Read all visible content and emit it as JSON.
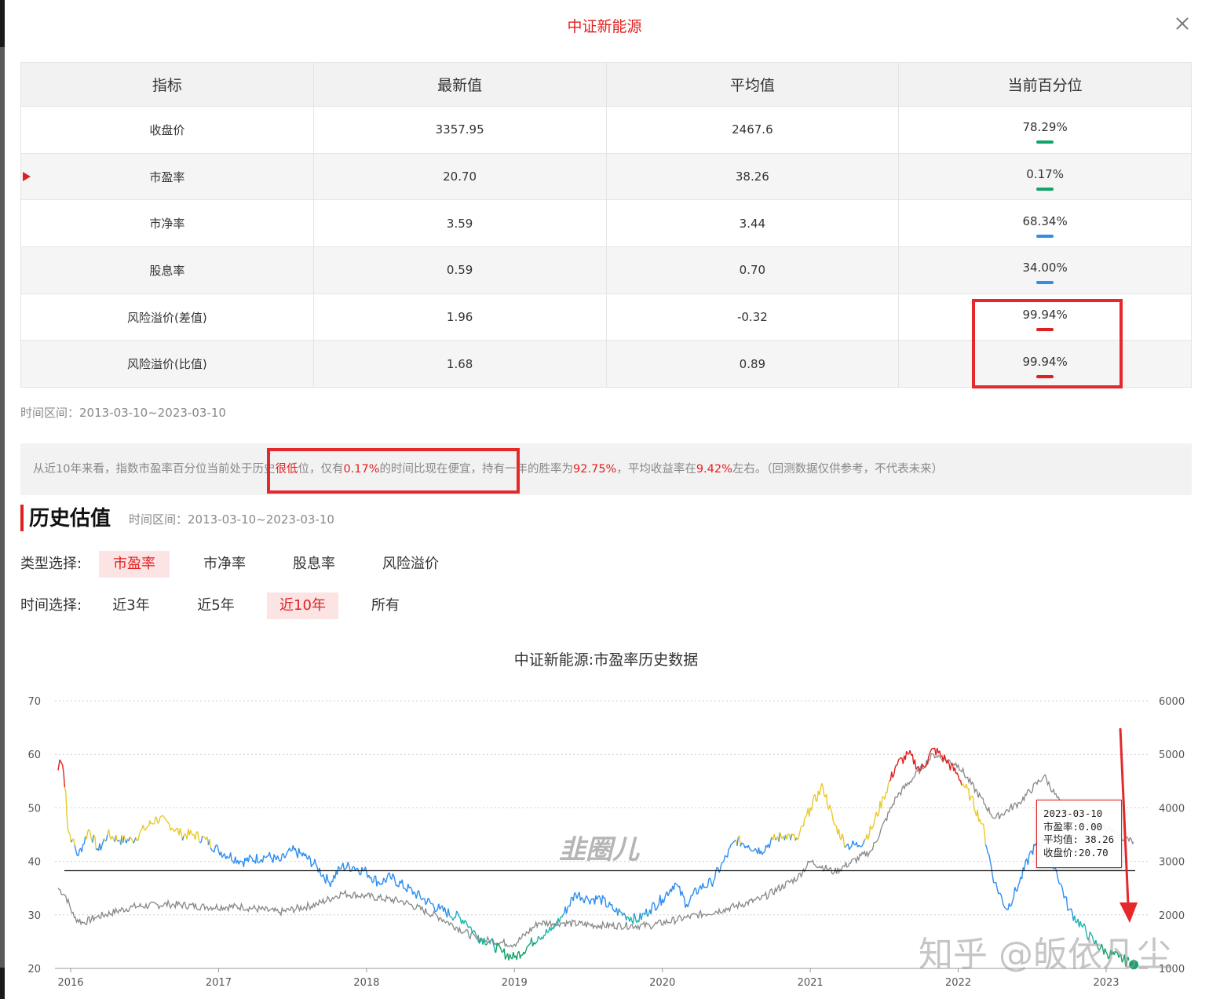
{
  "modal": {
    "title": "中证新能源"
  },
  "table": {
    "headers": [
      "指标",
      "最新值",
      "平均值",
      "当前百分位"
    ],
    "rows": [
      {
        "name": "收盘价",
        "latest": "3357.95",
        "avg": "2467.6",
        "pct": "78.29%",
        "bar_color": "#13a36b"
      },
      {
        "name": "市盈率",
        "latest": "20.70",
        "avg": "38.26",
        "pct": "0.17%",
        "bar_color": "#13a36b"
      },
      {
        "name": "市净率",
        "latest": "3.59",
        "avg": "3.44",
        "pct": "68.34%",
        "bar_color": "#2e8ef0"
      },
      {
        "name": "股息率",
        "latest": "0.59",
        "avg": "0.70",
        "pct": "34.00%",
        "bar_color": "#2e8ef0"
      },
      {
        "name": "风险溢价(差值)",
        "latest": "1.96",
        "avg": "-0.32",
        "pct": "99.94%",
        "bar_color": "#e02020"
      },
      {
        "name": "风险溢价(比值)",
        "latest": "1.68",
        "avg": "0.89",
        "pct": "99.94%",
        "bar_color": "#e02020"
      }
    ]
  },
  "range_text": "时间区间：2013-03-10~2023-03-10",
  "summary": {
    "p1": "从近10年来看，指数市盈率百分位当前处于历史",
    "r1": "很低",
    "p2": "位，仅有",
    "r2": "0.17%",
    "p3": "的时间比现在便宜，持有一年的胜率为",
    "r3": "92.75%",
    "p4": "，平均收益率在",
    "r4": "9.42%",
    "p5": "左右。（回测数据仅供参考，不代表未来）"
  },
  "history": {
    "title": "历史估值",
    "range": "时间区间：2013-03-10~2023-03-10",
    "type_label": "类型选择:",
    "types": [
      "市盈率",
      "市净率",
      "股息率",
      "风险溢价"
    ],
    "time_label": "时间选择:",
    "times": [
      "近3年",
      "近5年",
      "近10年",
      "所有"
    ]
  },
  "chart_data": {
    "type": "line",
    "title": "中证新能源:市盈率历史数据",
    "x_ticks": [
      "2016",
      "2017",
      "2018",
      "2019",
      "2020",
      "2021",
      "2022",
      "2023"
    ],
    "y_left": {
      "ticks": [
        20,
        30,
        40,
        50,
        60,
        70
      ],
      "range": [
        20,
        70
      ]
    },
    "y_right": {
      "ticks": [
        1000,
        2000,
        3000,
        4000,
        5000,
        6000
      ],
      "range": [
        1000,
        6000
      ]
    },
    "average_pe": 38.26,
    "series": [
      {
        "axis": "left",
        "color_bands": {
          "high": "#e02020",
          "mid": "#e8c92a",
          "low": "#2e8ef0",
          "very_low": "#1fb5b0",
          "bottom": "#13a36b"
        },
        "points": [
          [
            "2015-12-01",
            57
          ],
          [
            "2015-12-05",
            59
          ],
          [
            "2015-12-12",
            58
          ],
          [
            "2015-12-20",
            53
          ],
          [
            "2015-12-25",
            46
          ],
          [
            "2016-01-05",
            44
          ],
          [
            "2016-01-20",
            41
          ],
          [
            "2016-02-15",
            46
          ],
          [
            "2016-03-10",
            42
          ],
          [
            "2016-04-01",
            45
          ],
          [
            "2016-05-01",
            44
          ],
          [
            "2016-06-01",
            44
          ],
          [
            "2016-07-01",
            46
          ],
          [
            "2016-08-01",
            48
          ],
          [
            "2016-09-01",
            47
          ],
          [
            "2016-10-01",
            45
          ],
          [
            "2016-11-01",
            45
          ],
          [
            "2016-12-01",
            44
          ],
          [
            "2017-01-01",
            42
          ],
          [
            "2017-03-01",
            40
          ],
          [
            "2017-05-01",
            41
          ],
          [
            "2017-06-01",
            40
          ],
          [
            "2017-07-01",
            42
          ],
          [
            "2017-08-01",
            41
          ],
          [
            "2017-09-01",
            39
          ],
          [
            "2017-10-01",
            36
          ],
          [
            "2017-11-01",
            39
          ],
          [
            "2017-12-01",
            39
          ],
          [
            "2018-01-01",
            38
          ],
          [
            "2018-02-01",
            36
          ],
          [
            "2018-03-01",
            37
          ],
          [
            "2018-05-01",
            34
          ],
          [
            "2018-07-01",
            31
          ],
          [
            "2018-09-01",
            29
          ],
          [
            "2018-10-01",
            26
          ],
          [
            "2018-11-01",
            25
          ],
          [
            "2018-12-01",
            23
          ],
          [
            "2019-01-01",
            22
          ],
          [
            "2019-02-01",
            24
          ],
          [
            "2019-03-01",
            26
          ],
          [
            "2019-04-01",
            27
          ],
          [
            "2019-05-01",
            30
          ],
          [
            "2019-06-01",
            34
          ],
          [
            "2019-07-01",
            33
          ],
          [
            "2019-08-01",
            33
          ],
          [
            "2019-09-01",
            31
          ],
          [
            "2019-10-01",
            30
          ],
          [
            "2019-11-01",
            29
          ],
          [
            "2019-12-01",
            31
          ],
          [
            "2020-01-01",
            33
          ],
          [
            "2020-02-01",
            36
          ],
          [
            "2020-03-01",
            32
          ],
          [
            "2020-04-01",
            35
          ],
          [
            "2020-05-01",
            36
          ],
          [
            "2020-06-01",
            40
          ],
          [
            "2020-07-01",
            44
          ],
          [
            "2020-08-01",
            43
          ],
          [
            "2020-09-01",
            42
          ],
          [
            "2020-10-01",
            44
          ],
          [
            "2020-11-01",
            45
          ],
          [
            "2020-12-01",
            44
          ],
          [
            "2021-01-01",
            50
          ],
          [
            "2021-02-01",
            54
          ],
          [
            "2021-03-01",
            47
          ],
          [
            "2021-04-01",
            43
          ],
          [
            "2021-05-01",
            43
          ],
          [
            "2021-06-01",
            46
          ],
          [
            "2021-07-01",
            52
          ],
          [
            "2021-08-01",
            58
          ],
          [
            "2021-09-01",
            60
          ],
          [
            "2021-10-01",
            57
          ],
          [
            "2021-11-01",
            61
          ],
          [
            "2021-12-01",
            59
          ],
          [
            "2022-01-01",
            56
          ],
          [
            "2022-02-01",
            52
          ],
          [
            "2022-03-01",
            47
          ],
          [
            "2022-04-01",
            36
          ],
          [
            "2022-05-01",
            31
          ],
          [
            "2022-06-01",
            36
          ],
          [
            "2022-07-01",
            42
          ],
          [
            "2022-08-01",
            44
          ],
          [
            "2022-09-01",
            38
          ],
          [
            "2022-10-01",
            31
          ],
          [
            "2022-11-01",
            28
          ],
          [
            "2022-12-01",
            25
          ],
          [
            "2023-01-01",
            23
          ],
          [
            "2023-02-01",
            22
          ],
          [
            "2023-03-10",
            20.7
          ]
        ]
      },
      {
        "axis": "right",
        "color": "#888888",
        "points": [
          [
            "2015-12-01",
            2500
          ],
          [
            "2015-12-20",
            2350
          ],
          [
            "2016-01-10",
            1950
          ],
          [
            "2016-02-01",
            1850
          ],
          [
            "2016-03-01",
            1950
          ],
          [
            "2016-06-01",
            2150
          ],
          [
            "2016-09-01",
            2200
          ],
          [
            "2016-12-01",
            2150
          ],
          [
            "2017-03-01",
            2150
          ],
          [
            "2017-06-01",
            2050
          ],
          [
            "2017-09-01",
            2200
          ],
          [
            "2017-11-01",
            2400
          ],
          [
            "2018-01-01",
            2350
          ],
          [
            "2018-04-01",
            2250
          ],
          [
            "2018-07-01",
            1950
          ],
          [
            "2018-10-01",
            1550
          ],
          [
            "2019-01-01",
            1450
          ],
          [
            "2019-03-01",
            1850
          ],
          [
            "2019-05-01",
            1850
          ],
          [
            "2019-08-01",
            1800
          ],
          [
            "2019-12-01",
            1800
          ],
          [
            "2020-03-01",
            1950
          ],
          [
            "2020-06-01",
            2100
          ],
          [
            "2020-09-01",
            2300
          ],
          [
            "2020-12-01",
            2700
          ],
          [
            "2021-01-01",
            3000
          ],
          [
            "2021-03-01",
            2800
          ],
          [
            "2021-06-01",
            3200
          ],
          [
            "2021-08-01",
            4200
          ],
          [
            "2021-11-01",
            5000
          ],
          [
            "2022-01-01",
            4800
          ],
          [
            "2022-04-01",
            3800
          ],
          [
            "2022-06-01",
            4100
          ],
          [
            "2022-08-01",
            4600
          ],
          [
            "2022-10-01",
            3800
          ],
          [
            "2022-12-01",
            3700
          ],
          [
            "2023-01-01",
            3600
          ],
          [
            "2023-03-10",
            3357.95
          ]
        ]
      }
    ]
  },
  "tooltip": {
    "date": "2023-03-10",
    "pe": "市盈率:0.00",
    "avg": "平均值: 38.26",
    "close": "收盘价:20.70"
  },
  "watermark": {
    "text": "知乎 @皈依凡尘",
    "logo_text": "韭圈儿"
  },
  "colors": {
    "accent": "#e02020",
    "highlight_box": "#e5282b"
  }
}
